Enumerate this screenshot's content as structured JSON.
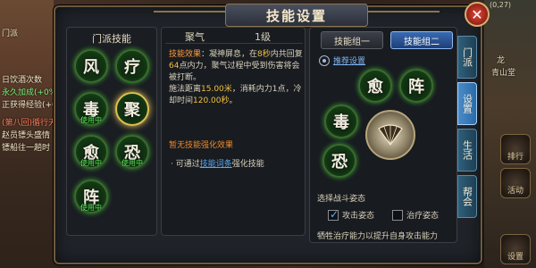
{
  "window": {
    "title": "技能设置"
  },
  "background": {
    "coords": "(0,27)",
    "map_labels": [
      "龙",
      "青山堂"
    ],
    "left_texts": [
      {
        "text": "门派",
        "cls": ""
      },
      {
        "text": "日饮酒次数",
        "cls": ""
      },
      {
        "text": "永久加成(+0%",
        "cls": "green"
      },
      {
        "text": "正获得经验(+0%",
        "cls": ""
      },
      {
        "text": "(第八回)循行天",
        "cls": "red"
      },
      {
        "text": "赵员镖头盛情",
        "cls": ""
      },
      {
        "text": "镖船往一趟时",
        "cls": ""
      }
    ],
    "right_buttons": [
      "排行",
      "活动",
      "设置"
    ]
  },
  "sect_skills": {
    "header": "门派技能",
    "items": [
      {
        "char": "风",
        "badge": ""
      },
      {
        "char": "疗",
        "badge": ""
      },
      {
        "char": "毒",
        "badge": "使用中"
      },
      {
        "char": "聚",
        "badge": ""
      },
      {
        "char": "愈",
        "badge": "使用中"
      },
      {
        "char": "恐",
        "badge": "使用中"
      },
      {
        "char": "阵",
        "badge": "使用中"
      }
    ]
  },
  "detail": {
    "skill_name": "聚气",
    "level": "1级",
    "effect_label": "技能效果",
    "effect_text_a": "：凝神屏息，在",
    "seconds_a": "8秒",
    "effect_text_b": "内共回复",
    "points": "64",
    "effect_text_c": "点内力，聚气过程中受到伤害将会被打断。",
    "range_text": "施法距离",
    "range": "15.00米",
    "cost_text": "，消耗内力1点，冷却时间",
    "cooldown": "120.00秒",
    "end": "。",
    "no_enhance": "暂无技能强化效果",
    "upgrade_prefix": "· 可通过",
    "upgrade_link": "技能词条",
    "upgrade_suffix": "强化技能"
  },
  "groups": {
    "tab_one": "技能组一",
    "tab_two": "技能组二",
    "recommend": "推荐设置",
    "slots": [
      "愈",
      "阵",
      "毒",
      "恐"
    ],
    "stance_title": "选择战斗姿态",
    "attack_stance": "攻击姿态",
    "heal_stance": "治疗姿态",
    "attack_checked": true,
    "heal_checked": false,
    "sacrifice_text": "牺牲治疗能力以提升自身攻击能力"
  },
  "side_tabs": [
    {
      "label": "门派",
      "active": false
    },
    {
      "label": "设置",
      "active": true
    },
    {
      "label": "生活",
      "active": false
    },
    {
      "label": "帮会",
      "active": false
    }
  ],
  "colors": {
    "accent": "#3a6ab0",
    "highlight": "#f0c040",
    "badge_green": "#5ef05e"
  }
}
